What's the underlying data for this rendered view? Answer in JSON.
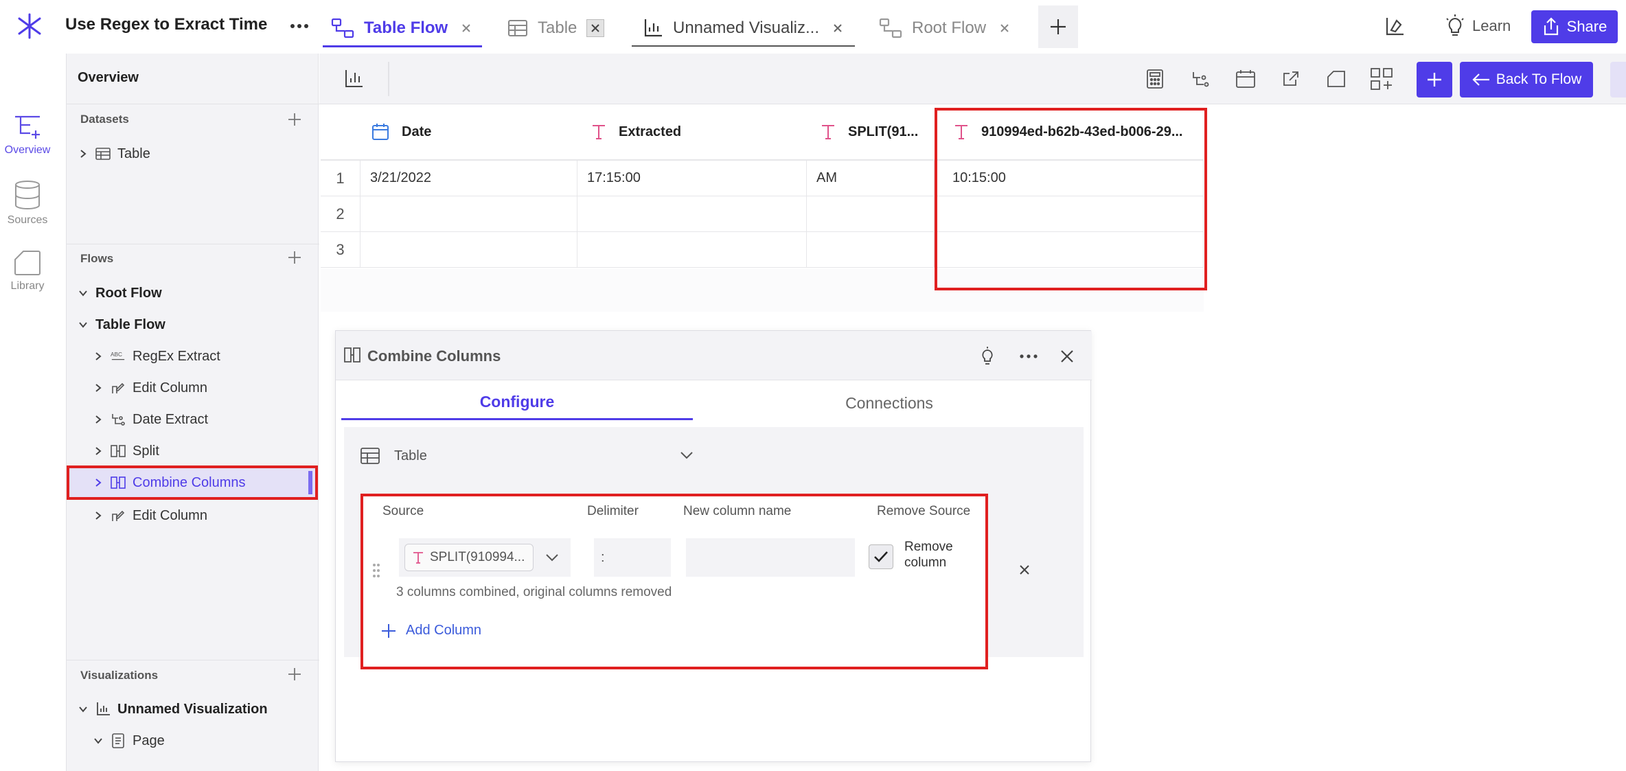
{
  "app": {
    "title": "Use Regex to Exract Time"
  },
  "tabs": [
    {
      "label": "Table Flow",
      "active": true
    },
    {
      "label": "Table",
      "active": false
    },
    {
      "label": "Unnamed Visualiz...",
      "active": false
    },
    {
      "label": "Root Flow",
      "active": false
    }
  ],
  "topbar": {
    "learn_label": "Learn",
    "share_label": "Share"
  },
  "rail": [
    {
      "label": "Overview",
      "icon": "overview-icon",
      "active": true
    },
    {
      "label": "Sources",
      "icon": "database-icon",
      "active": false
    },
    {
      "label": "Library",
      "icon": "library-icon",
      "active": false
    }
  ],
  "sidebar": {
    "overview_label": "Overview",
    "datasets": {
      "title": "Datasets",
      "items": [
        {
          "label": "Table"
        }
      ]
    },
    "flows": {
      "title": "Flows",
      "items": [
        {
          "label": "Root Flow",
          "bold": true
        },
        {
          "label": "Table Flow",
          "bold": true
        },
        {
          "label": "RegEx Extract",
          "icon": "regex-icon"
        },
        {
          "label": "Edit Column",
          "icon": "edit-column-icon"
        },
        {
          "label": "Date Extract",
          "icon": "date-extract-icon"
        },
        {
          "label": "Split",
          "icon": "split-icon"
        },
        {
          "label": "Combine Columns",
          "icon": "combine-columns-icon",
          "selected": true
        },
        {
          "label": "Edit Column",
          "icon": "edit-column-icon"
        }
      ]
    },
    "visualizations": {
      "title": "Visualizations",
      "items": [
        {
          "label": "Unnamed Visualization",
          "bold": true
        },
        {
          "label": "Page"
        }
      ]
    }
  },
  "toolbar": {
    "back_label": "Back To Flow"
  },
  "table": {
    "columns": [
      {
        "name": "Date",
        "type_icon": "calendar-icon"
      },
      {
        "name": "Extracted",
        "type_icon": "text-type-icon"
      },
      {
        "name": "SPLIT(91...",
        "type_icon": "text-type-icon"
      },
      {
        "name": "910994ed-b62b-43ed-b006-29...",
        "type_icon": "text-type-icon"
      }
    ],
    "rows": [
      {
        "num": "1",
        "cells": [
          "3/21/2022",
          "17:15:00",
          "AM",
          "10:15:00"
        ]
      },
      {
        "num": "2",
        "cells": [
          "",
          "",
          "",
          ""
        ]
      },
      {
        "num": "3",
        "cells": [
          "",
          "",
          "",
          ""
        ]
      }
    ]
  },
  "panel": {
    "title": "Combine Columns",
    "tabs": {
      "configure": "Configure",
      "connections": "Connections"
    },
    "dataset_select": "Table",
    "headers": {
      "source": "Source",
      "delimiter": "Delimiter",
      "new_name": "New column name",
      "remove_source": "Remove Source"
    },
    "row": {
      "source_chip": "SPLIT(910994...",
      "delimiter_value": ":",
      "new_name_value": "",
      "remove_checked": true,
      "remove_label": "Remove column"
    },
    "note": "3 columns combined, original columns removed",
    "add_column_label": "Add Column"
  },
  "colors": {
    "accent": "#4f3ce8",
    "highlight": "#e02020",
    "text_type": "#e0528a",
    "calendar": "#3b7be0"
  }
}
